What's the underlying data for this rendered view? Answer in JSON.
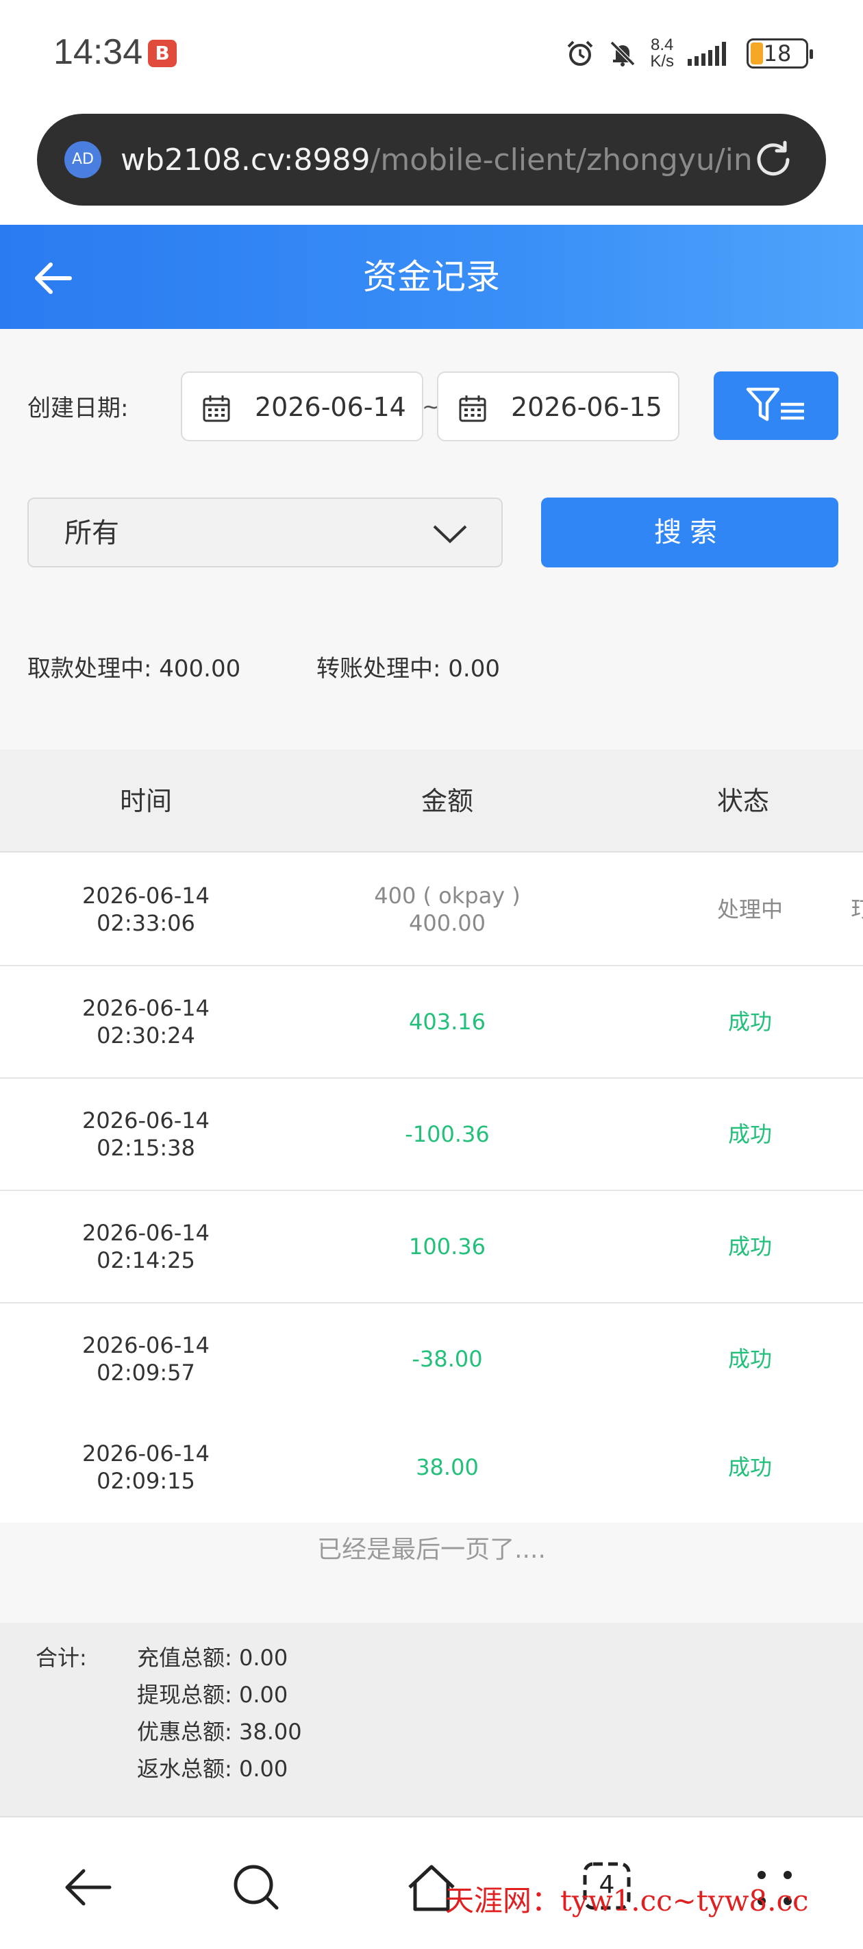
{
  "status_bar": {
    "time": "14:34",
    "net_speed_value": "8.4",
    "net_speed_unit": "K/s",
    "battery": "18",
    "notification_badge": "B"
  },
  "browser": {
    "ad_badge": "AD",
    "url_host": "wb2108.cv:8989",
    "url_path": "/mobile-client/zhongyu/inc"
  },
  "header": {
    "title": "资金记录"
  },
  "filters": {
    "date_label": "创建日期:",
    "start_date": "2026-06-14",
    "separator": "~",
    "end_date": "2026-06-15",
    "type_select": "所有",
    "search_label": "搜索"
  },
  "summary": {
    "withdraw_label": "取款处理中:",
    "withdraw_value": "400.00",
    "transfer_label": "转账处理中:",
    "transfer_value": "0.00"
  },
  "table": {
    "headers": {
      "time": "时间",
      "amount": "金额",
      "status": "状态"
    },
    "rows": [
      {
        "date": "2026-06-14",
        "time": "02:33:06",
        "amount_line1": "400 ( okpay )",
        "amount_line2": "400.00",
        "status": "处理中",
        "extra": "玎"
      },
      {
        "date": "2026-06-14",
        "time": "02:30:24",
        "amount_line1": "403.16",
        "status": "成功"
      },
      {
        "date": "2026-06-14",
        "time": "02:15:38",
        "amount_line1": "-100.36",
        "status": "成功"
      },
      {
        "date": "2026-06-14",
        "time": "02:14:25",
        "amount_line1": "100.36",
        "status": "成功"
      },
      {
        "date": "2026-06-14",
        "time": "02:09:57",
        "amount_line1": "-38.00",
        "status": "成功"
      },
      {
        "date": "2026-06-14",
        "time": "02:09:15",
        "amount_line1": "38.00",
        "status": "成功"
      }
    ],
    "end_message": "已经是最后一页了...."
  },
  "totals": {
    "label": "合计:",
    "items": [
      {
        "label": "充值总额:",
        "value": "0.00"
      },
      {
        "label": "提现总额:",
        "value": "0.00"
      },
      {
        "label": "优惠总额:",
        "value": "38.00"
      },
      {
        "label": "返水总额:",
        "value": "0.00"
      }
    ]
  },
  "nav": {
    "tabs_count": "4"
  },
  "watermark": "天涯网：tyw1.cc~tyw8.cc",
  "colors": {
    "primary": "#2f86f4",
    "success": "#22c07a",
    "pending": "#8a8a8a"
  }
}
